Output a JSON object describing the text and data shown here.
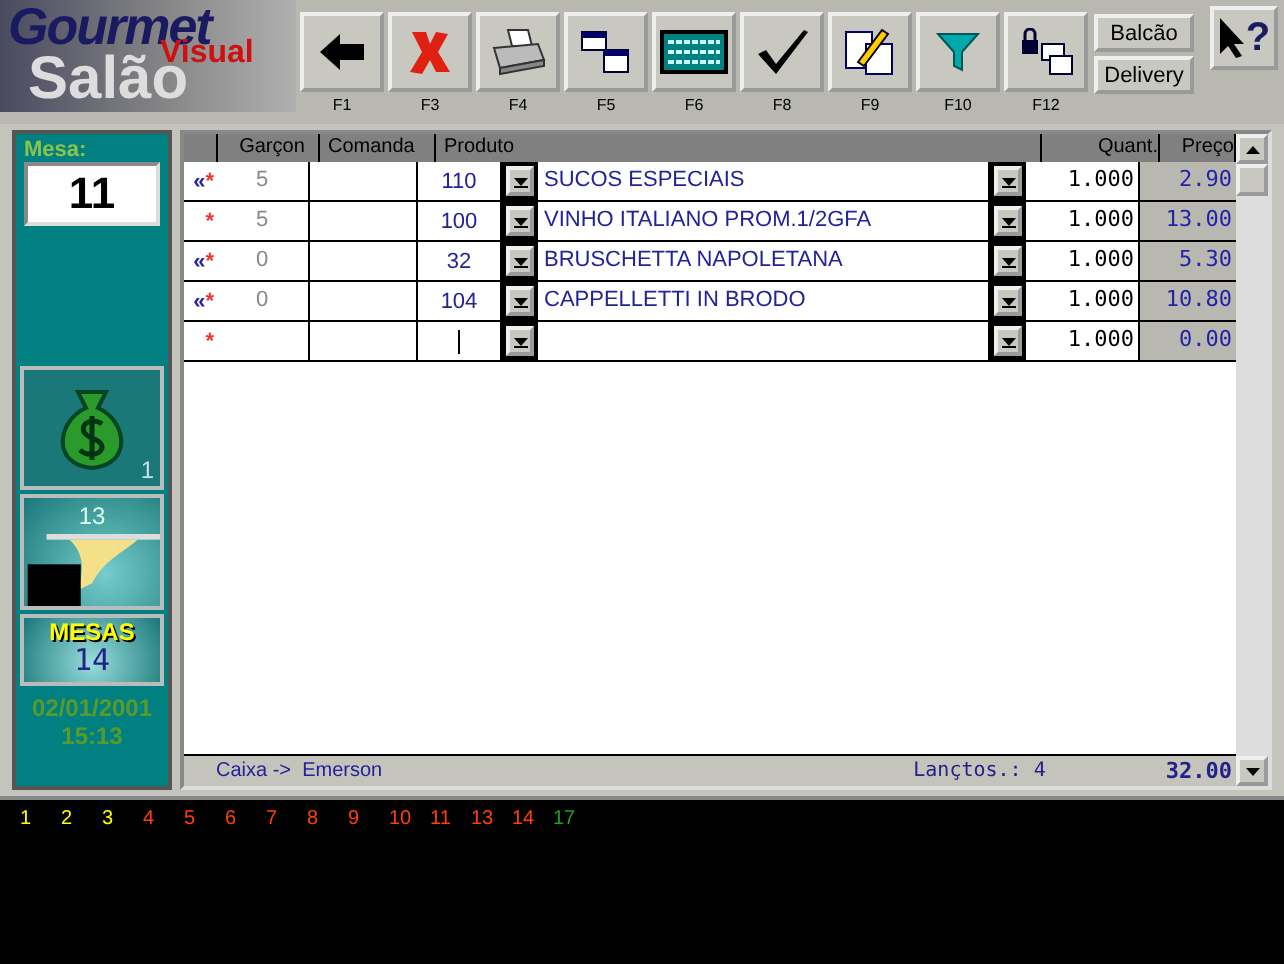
{
  "logo": {
    "line_1": "Gourmet",
    "line_2": "Visual",
    "line_3": "Salão"
  },
  "toolbar": [
    {
      "kind": "back",
      "key": "F1"
    },
    {
      "kind": "cancel",
      "key": "F3"
    },
    {
      "kind": "print",
      "key": "F4"
    },
    {
      "kind": "windows",
      "key": "F5"
    },
    {
      "kind": "keypad",
      "key": "F6"
    },
    {
      "kind": "check",
      "key": "F8"
    },
    {
      "kind": "note",
      "key": "F9"
    },
    {
      "kind": "filter",
      "key": "F10"
    },
    {
      "kind": "lock",
      "key": "F12"
    }
  ],
  "mode_buttons": [
    "Balcão",
    "Delivery"
  ],
  "help": {
    "glyph": "?"
  },
  "mesa": {
    "label": "Mesa:",
    "value": "11"
  },
  "tiles": [
    {
      "kind": "money",
      "count": "1"
    },
    {
      "kind": "waiter",
      "count": "13"
    },
    {
      "kind": "tables",
      "label": "MESAS",
      "count": "14"
    }
  ],
  "date": "02/01/2001",
  "time": "15:13",
  "table": {
    "columns": [
      "Garçon",
      "Comanda",
      "Produto",
      "Quant.",
      "Preço"
    ],
    "rows": [
      {
        "link": "«",
        "star": "*",
        "garcon": "5",
        "code": "110",
        "product": "SUCOS ESPECIAIS",
        "qty": "1.000",
        "price": "2.90"
      },
      {
        "star": "*",
        "garcon": "5",
        "code": "100",
        "product": "VINHO ITALIANO PROM.1/2GFA",
        "qty": "1.000",
        "price": "13.00"
      },
      {
        "link": "«",
        "star": "*",
        "garcon": "0",
        "code": "32",
        "product": "BRUSCHETTA NAPOLETANA",
        "qty": "1.000",
        "price": "5.30"
      },
      {
        "link": "«",
        "star": "*",
        "garcon": "0",
        "code": "104",
        "product": "CAPPELLETTI IN BRODO",
        "qty": "1.000",
        "price": "10.80"
      },
      {
        "star": "*",
        "qty": "1.000",
        "price": "0.00"
      }
    ]
  },
  "status": {
    "cashier": "Caixa ->  Emerson",
    "count_label": "Lançtos.:",
    "count": "4",
    "total": "32.00"
  },
  "table_numbers": [
    {
      "number": "1",
      "color": "#ffff00"
    },
    {
      "number": "2",
      "color": "#ffff00"
    },
    {
      "number": "3",
      "color": "#ffff00"
    },
    {
      "number": "4",
      "color": "#ff4000"
    },
    {
      "number": "5",
      "color": "#ff4000"
    },
    {
      "number": "6",
      "color": "#ff4000"
    },
    {
      "number": "7",
      "color": "#ff4000"
    },
    {
      "number": "8",
      "color": "#ff4000"
    },
    {
      "number": "9",
      "color": "#ff4000"
    },
    {
      "number": "10",
      "color": "#ff4000"
    },
    {
      "number": "11",
      "color": "#ff4000"
    },
    {
      "number": "13",
      "color": "#ff4000"
    },
    {
      "number": "14",
      "color": "#ff4000"
    },
    {
      "number": "17",
      "color": "#20a020"
    }
  ]
}
